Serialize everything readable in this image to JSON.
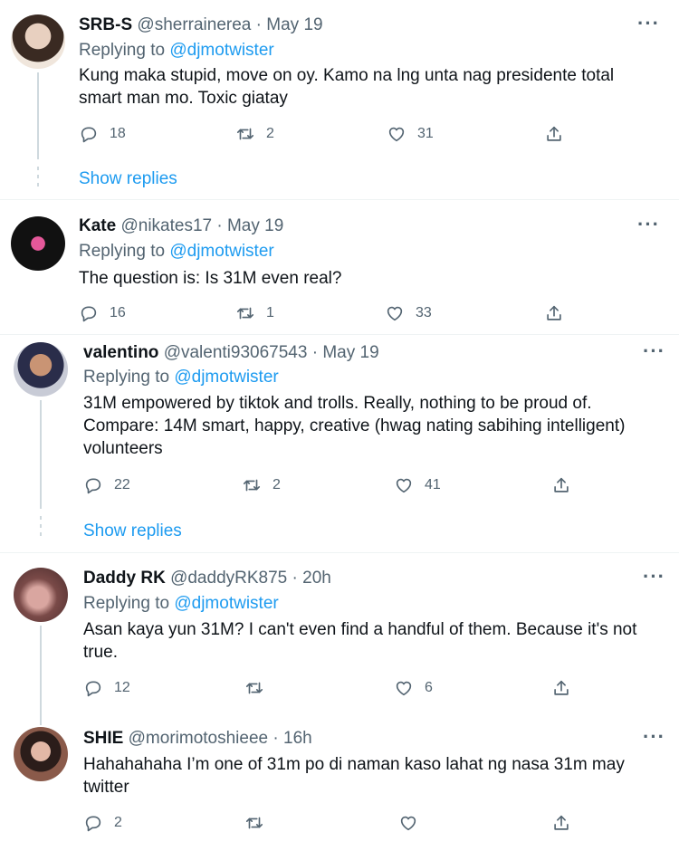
{
  "tweets": [
    {
      "name": "SRB-S",
      "handle": "@sherrainerea",
      "time": "May 19",
      "replying_prefix": "Replying to",
      "mention": "@djmotwister",
      "text": "Kung maka stupid, move on oy. Kamo na lng unta nag presidente total smart man mo. Toxic giatay",
      "replies": "18",
      "retweets": "2",
      "likes": "31",
      "show_replies": "Show replies"
    },
    {
      "name": "Kate",
      "handle": "@nikates17",
      "time": "May 19",
      "replying_prefix": "Replying to",
      "mention": "@djmotwister",
      "text": "The question is: Is 31M even real?",
      "replies": "16",
      "retweets": "1",
      "likes": "33"
    },
    {
      "name": "valentino",
      "handle": "@valenti93067543",
      "time": "May 19",
      "replying_prefix": "Replying to",
      "mention": "@djmotwister",
      "text": "31M empowered by tiktok and trolls. Really, nothing to be proud of. Compare: 14M smart, happy, creative (hwag nating sabihing intelligent) volunteers",
      "replies": "22",
      "retweets": "2",
      "likes": "41",
      "show_replies": "Show replies"
    },
    {
      "name": "Daddy RK",
      "handle": "@daddyRK875",
      "time": "20h",
      "replying_prefix": "Replying to",
      "mention": "@djmotwister",
      "text": "Asan kaya yun 31M?  I can't even find a handful of them. Because it's not true.",
      "replies": "12",
      "retweets": "",
      "likes": "6"
    },
    {
      "name": "SHIE",
      "handle": "@morimotoshieee",
      "time": "16h",
      "text": "Hahahahaha I’m one of 31m po di naman kaso lahat ng nasa 31m may twitter",
      "replies": "2",
      "retweets": "",
      "likes": ""
    }
  ],
  "icons": {
    "reply": "reply-icon",
    "retweet": "retweet-icon",
    "like": "like-icon",
    "share": "share-icon",
    "more": "more-icon"
  },
  "colors": {
    "accent": "#1d9bf0",
    "secondary_text": "#536471",
    "primary_text": "#0f1419",
    "thread_line": "#cfd9de"
  }
}
